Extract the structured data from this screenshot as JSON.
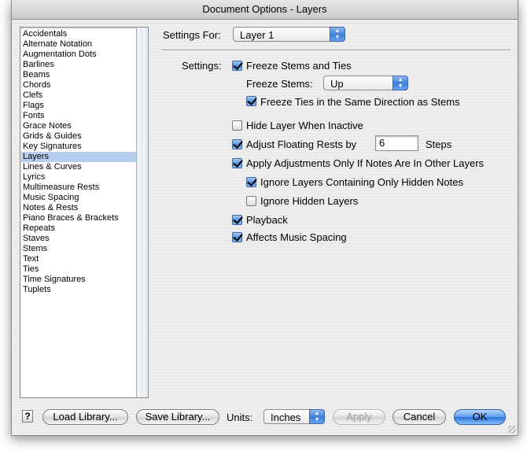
{
  "window": {
    "title": "Document Options - Layers"
  },
  "sidebar": {
    "items": [
      "Accidentals",
      "Alternate Notation",
      "Augmentation Dots",
      "Barlines",
      "Beams",
      "Chords",
      "Clefs",
      "Flags",
      "Fonts",
      "Grace Notes",
      "Grids & Guides",
      "Key Signatures",
      "Layers",
      "Lines & Curves",
      "Lyrics",
      "Multimeasure Rests",
      "Music Spacing",
      "Notes & Rests",
      "Piano Braces & Brackets",
      "Repeats",
      "Staves",
      "Stems",
      "Text",
      "Ties",
      "Time Signatures",
      "Tuplets"
    ],
    "selected": "Layers"
  },
  "settings_for": {
    "label": "Settings For:",
    "value": "Layer 1"
  },
  "settings_label": "Settings:",
  "options": {
    "freeze_stems_ties": {
      "label": "Freeze Stems and Ties",
      "checked": true
    },
    "freeze_stems": {
      "label": "Freeze Stems:",
      "value": "Up"
    },
    "freeze_ties_same_dir": {
      "label": "Freeze Ties in the Same Direction as Stems",
      "checked": true
    },
    "hide_layer_inactive": {
      "label": "Hide Layer When Inactive",
      "checked": false
    },
    "adjust_floating_rests": {
      "label": "Adjust Floating Rests by",
      "value": "6",
      "suffix": "Steps",
      "checked": true
    },
    "apply_adjustments": {
      "label": "Apply Adjustments Only If Notes Are In Other Layers",
      "checked": true
    },
    "ignore_hidden_notes_layers": {
      "label": "Ignore Layers Containing Only Hidden Notes",
      "checked": true
    },
    "ignore_hidden_layers": {
      "label": "Ignore Hidden Layers",
      "checked": false
    },
    "playback": {
      "label": "Playback",
      "checked": true
    },
    "affects_spacing": {
      "label": "Affects Music Spacing",
      "checked": true
    }
  },
  "footer": {
    "help": "?",
    "load_library": "Load Library...",
    "save_library": "Save Library...",
    "units_label": "Units:",
    "units_value": "Inches",
    "apply": "Apply",
    "cancel": "Cancel",
    "ok": "OK"
  },
  "colors": {
    "accent": "#3a7fd9",
    "selection": "#b5cdee"
  }
}
